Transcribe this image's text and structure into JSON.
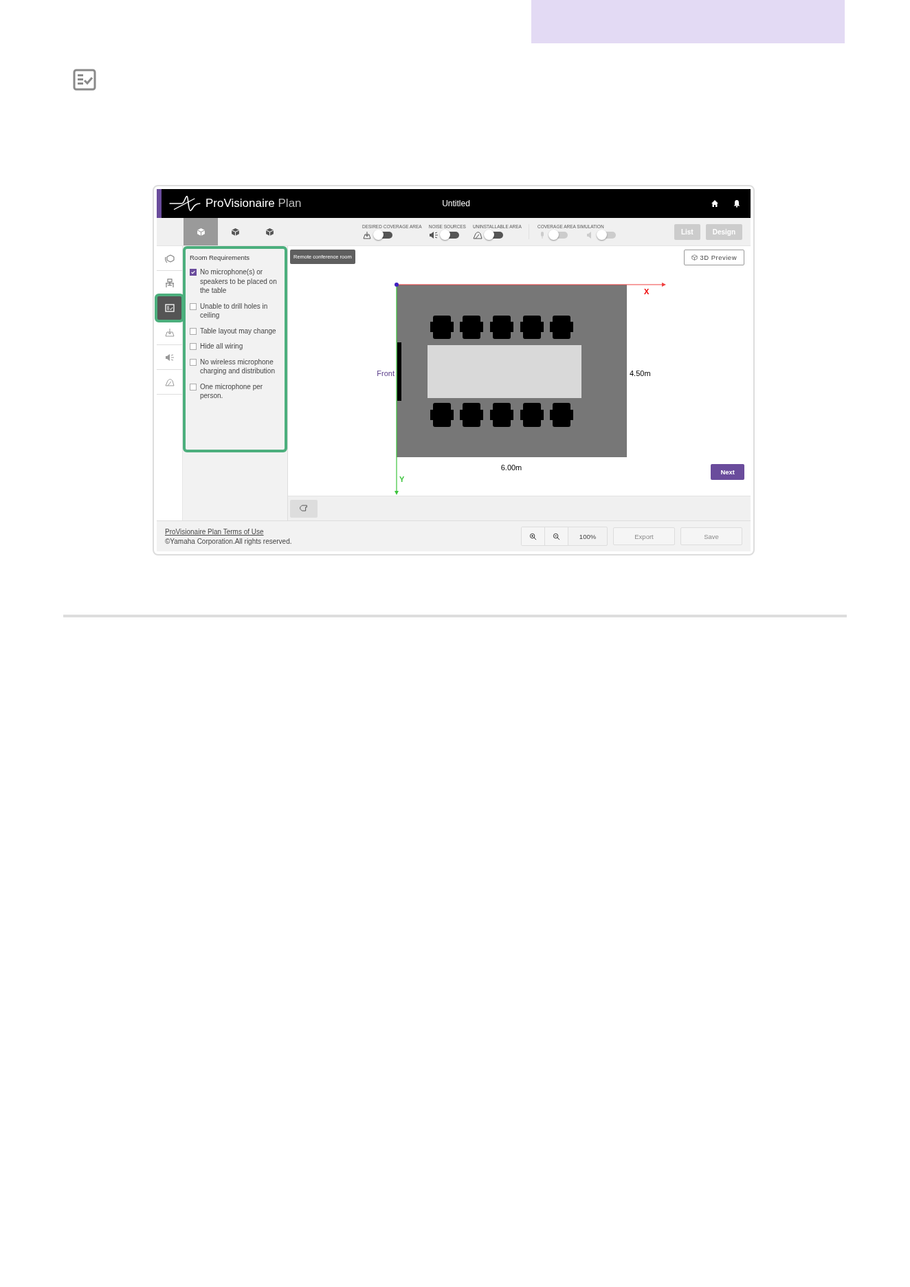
{
  "app": {
    "brand": {
      "name": "ProVisionaire",
      "suffix": "Plan"
    },
    "title": "Untitled",
    "view_tabs": [
      {
        "selected": true
      },
      {
        "selected": false
      },
      {
        "selected": false
      }
    ],
    "toggle_groups": [
      {
        "label": "DESIRED COVERAGE AREA",
        "toggles": [
          {
            "on": false,
            "disabled": false
          }
        ]
      },
      {
        "label": "NOISE SOURCES",
        "toggles": [
          {
            "on": false,
            "disabled": false
          }
        ]
      },
      {
        "label": "UNINSTALLABLE AREA",
        "toggles": [
          {
            "on": false,
            "disabled": false
          }
        ]
      },
      {
        "label": "COVERAGE AREA SIMULATION",
        "toggles": [
          {
            "on": false,
            "disabled": true
          },
          {
            "on": false,
            "disabled": true
          }
        ]
      }
    ],
    "mode_buttons": [
      {
        "label": "List",
        "disabled": true
      },
      {
        "label": "Design",
        "disabled": true
      }
    ],
    "side_tools": [
      {
        "selected": false
      },
      {
        "selected": false
      },
      {
        "selected": true
      },
      {
        "selected": false
      },
      {
        "selected": false
      },
      {
        "selected": false
      }
    ],
    "requirements": {
      "title": "Room Requirements",
      "items": [
        {
          "label": "No microphone(s) or speakers to be placed on the table",
          "checked": true
        },
        {
          "label": "Unable to drill holes in ceiling",
          "checked": false
        },
        {
          "label": "Table layout may change",
          "checked": false
        },
        {
          "label": "Hide all wiring",
          "checked": false
        },
        {
          "label": "No wireless microphone charging and distribution",
          "checked": false
        },
        {
          "label": "One microphone per person.",
          "checked": false
        }
      ]
    },
    "canvas": {
      "room_name": "Remote conference room",
      "preview_button": "3D Preview",
      "x_axis": "X",
      "y_axis": "Y",
      "front_label": "Front",
      "depth": "4.50m",
      "width": "6.00m",
      "next_button": "Next"
    },
    "footer": {
      "terms_link": "ProVisionaire Plan Terms of Use",
      "copyright": "©Yamaha Corporation.All rights reserved.",
      "zoom": "100%",
      "export_button": {
        "label": "Export",
        "disabled": true
      },
      "save_button": {
        "label": "Save",
        "disabled": true
      }
    }
  }
}
